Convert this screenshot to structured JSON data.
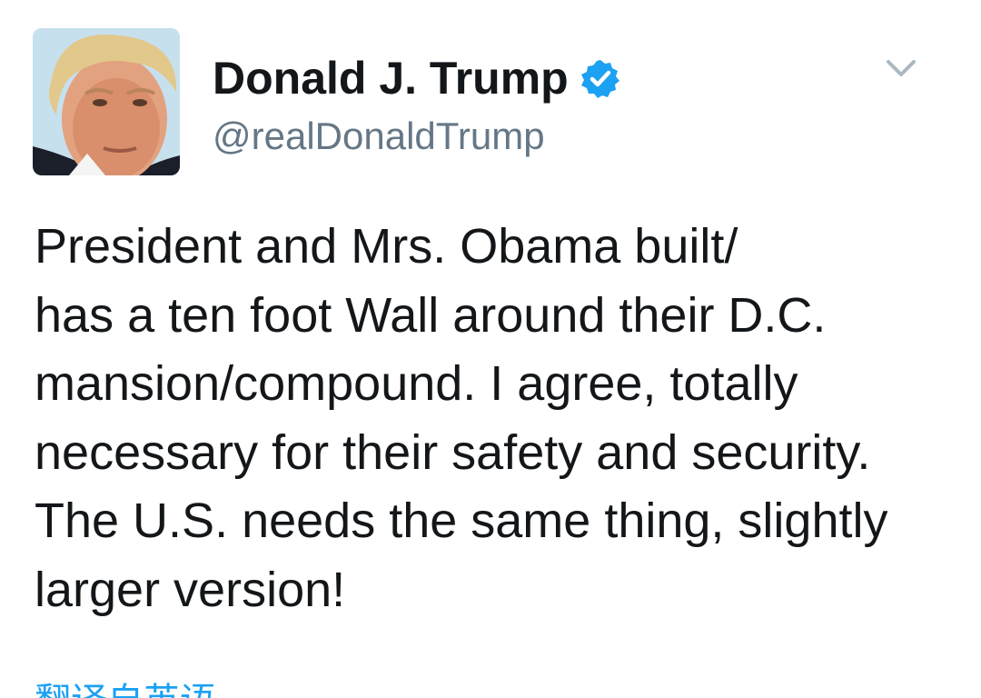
{
  "author": {
    "display_name": "Donald J. Trump",
    "handle": "@realDonaldTrump",
    "verified": true
  },
  "icons": {
    "verified": "verified-badge-icon",
    "menu": "chevron-down-icon"
  },
  "tweet": {
    "lines": [
      "President and Mrs. Obama built/",
      "has a ten foot Wall around their D.C.",
      "mansion/compound. I agree, totally",
      "necessary for their safety and security.",
      "The U.S. needs the same thing, slightly",
      "larger version!"
    ]
  },
  "translate": {
    "label": "翻译自英语"
  },
  "colors": {
    "text": "#14171a",
    "secondary": "#657786",
    "accent": "#1da1f2"
  }
}
